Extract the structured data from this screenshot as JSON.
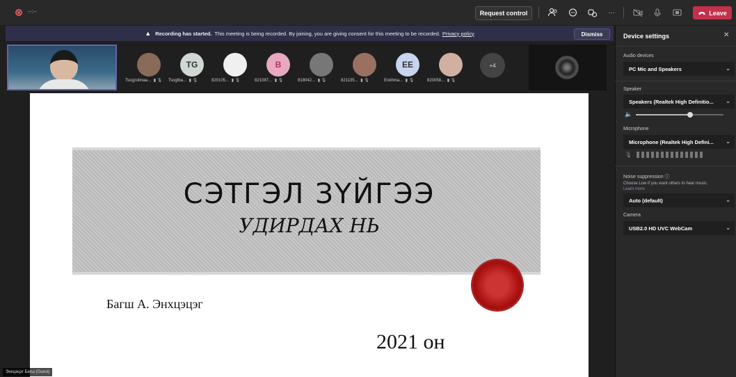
{
  "topbar": {
    "timer": "--:--",
    "request_control_label": "Request control",
    "more_label": "···",
    "leave_label": "Leave",
    "accent": "#c4314b"
  },
  "banner": {
    "bold": "Recording has started.",
    "text": "This meeting is being recorded. By joining, you are giving consent for this meeting to be recorded.",
    "link": "Privacy policy",
    "dismiss_label": "Dismiss"
  },
  "participants": [
    {
      "name": "Tsogzolmaa...",
      "initials": "",
      "color": "#8a6a5a"
    },
    {
      "name": "Tsogtba...",
      "initials": "TG",
      "color": "#cfd8d2"
    },
    {
      "name": "820105...",
      "initials": "",
      "color": "#f0f0f0"
    },
    {
      "name": "821087...",
      "initials": "B",
      "color": "#e8a8c0"
    },
    {
      "name": "818042...",
      "initials": "",
      "color": "#777777"
    },
    {
      "name": "821135...",
      "initials": "",
      "color": "#9a7060"
    },
    {
      "name": "Enkhma...",
      "initials": "EE",
      "color": "#c8d4f0"
    },
    {
      "name": "820058...",
      "initials": "",
      "color": "#d0b0a0"
    }
  ],
  "more_participants": "+4",
  "slide": {
    "title": "СЭТГЭЛ ЗҮЙГЭЭ",
    "subtitle": "УДИРДАХ НЬ",
    "teacher": "Багш А. Энхцэцэг",
    "year": "2021 он"
  },
  "presenter_label": "Энхцэцэг Багш (Guest)",
  "device_settings": {
    "title": "Device settings",
    "audio_devices_label": "Audio devices",
    "audio_device": "PC Mic and Speakers",
    "speaker_label": "Speaker",
    "speaker": "Speakers (Realtek High Definitio...",
    "speaker_volume": 0.62,
    "microphone_label": "Microphone",
    "microphone": "Microphone (Realtek High Defini...",
    "noise_label": "Noise suppression",
    "noise_desc": "Choose Low if you want others to hear music.",
    "learn_more": "Learn more",
    "noise_value": "Auto (default)",
    "camera_label": "Camera",
    "camera": "USB2.0 HD UVC WebCam"
  }
}
